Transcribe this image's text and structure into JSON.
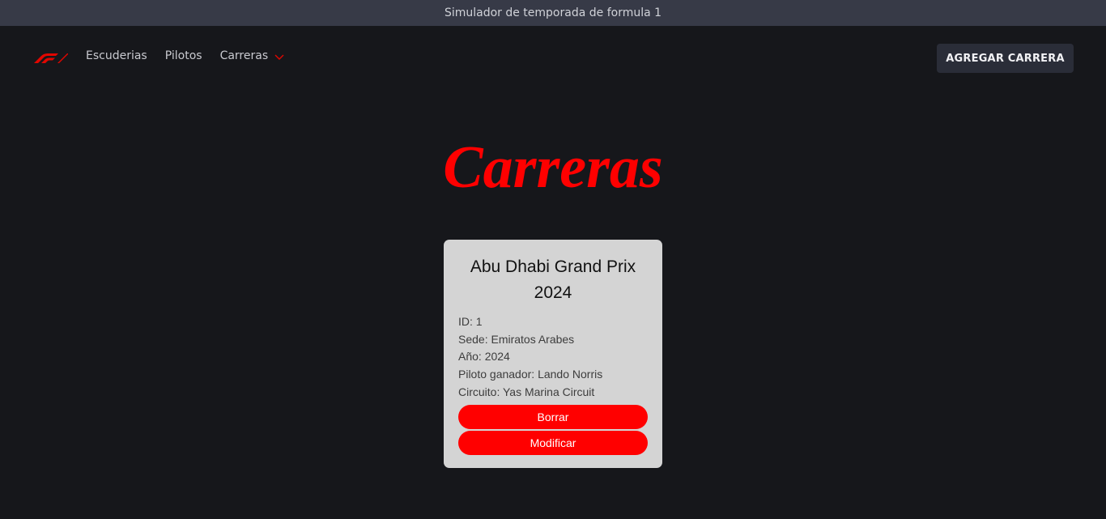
{
  "window": {
    "title": "Simulador de temporada de formula 1"
  },
  "nav": {
    "logo": "f1-logo",
    "links": [
      "Escuderias",
      "Pilotos",
      "Carreras"
    ],
    "cta": "AGREGAR CARRERA"
  },
  "page": {
    "title": "Carreras"
  },
  "races": [
    {
      "title": "Abu Dhabi Grand Prix 2024",
      "lines": [
        "ID: 1",
        "Sede: Emiratos Arabes",
        "Año: 2024",
        "Piloto ganador: Lando Norris",
        "Circuito: Yas Marina Circuit"
      ],
      "delete_label": "Borrar",
      "edit_label": "Modificar"
    }
  ],
  "colors": {
    "accent": "#ff0000",
    "background": "#16171b",
    "titlebar": "#373a47",
    "card": "#d4d4d4",
    "button_dark": "#2a2d38"
  }
}
